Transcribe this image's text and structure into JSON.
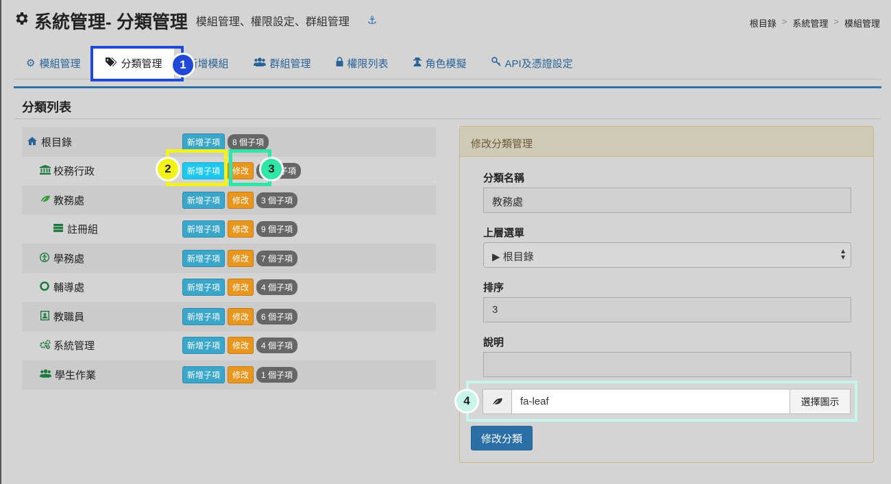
{
  "header": {
    "title": "系統管理- 分類管理",
    "subtitle": "模組管理、權限設定、群組管理",
    "gear_icon": "gear-icon",
    "anchor_icon": "anchor-icon"
  },
  "breadcrumb": {
    "items": [
      "根目錄",
      "系統管理",
      "模組管理"
    ],
    "sep": ">"
  },
  "tabs": [
    {
      "label": "模組管理",
      "icon": "gear-icon"
    },
    {
      "label": "分類管理",
      "icon": "tags-icon"
    },
    {
      "label": "新增模組",
      "icon": ""
    },
    {
      "label": "群組管理",
      "icon": "users-icon"
    },
    {
      "label": "權限列表",
      "icon": "lock-icon"
    },
    {
      "label": "角色模擬",
      "icon": "user-secret-icon"
    },
    {
      "label": "API及憑證設定",
      "icon": "key-icon"
    }
  ],
  "annotations": [
    "1",
    "2",
    "3",
    "4"
  ],
  "panel": {
    "title": "分類列表"
  },
  "tree": {
    "add_label": "新增子項",
    "edit_label": "修改",
    "rows": [
      {
        "name": "根目錄",
        "icon": "home-icon",
        "count": "8 個子項"
      },
      {
        "name": "校務行政",
        "icon": "institution-icon",
        "count": "個子項"
      },
      {
        "name": "教務處",
        "icon": "leaf-icon",
        "count": "3 個子項"
      },
      {
        "name": "註冊組",
        "icon": "server-icon",
        "count": "9 個子項"
      },
      {
        "name": "學務處",
        "icon": "child-icon",
        "count": "7 個子項"
      },
      {
        "name": "輔導處",
        "icon": "life-ring-icon",
        "count": "4 個子項"
      },
      {
        "name": "教職員",
        "icon": "id-card-icon",
        "count": "6 個子項"
      },
      {
        "name": "系統管理",
        "icon": "cogs-icon",
        "count": "4 個子項"
      },
      {
        "name": "學生作業",
        "icon": "users-icon",
        "count": "1 個子項"
      }
    ]
  },
  "edit_form": {
    "heading": "修改分類管理",
    "name_label": "分類名稱",
    "name_value": "教務處",
    "parent_label": "上層選單",
    "parent_value": "▶ 根目錄",
    "order_label": "排序",
    "order_value": "3",
    "desc_label": "說明",
    "desc_value": "",
    "icon_value": "fa-leaf",
    "pick_icon_label": "選擇圖示",
    "submit_label": "修改分類"
  },
  "colors": {
    "accent": "#2a6fa8",
    "add_btn": "#3aa6c9",
    "edit_btn": "#e8961e",
    "hl1": "#1f49d6",
    "hl2": "#f3f31a",
    "hl3": "#2ee6a6",
    "hl4": "#c8f5e9"
  }
}
